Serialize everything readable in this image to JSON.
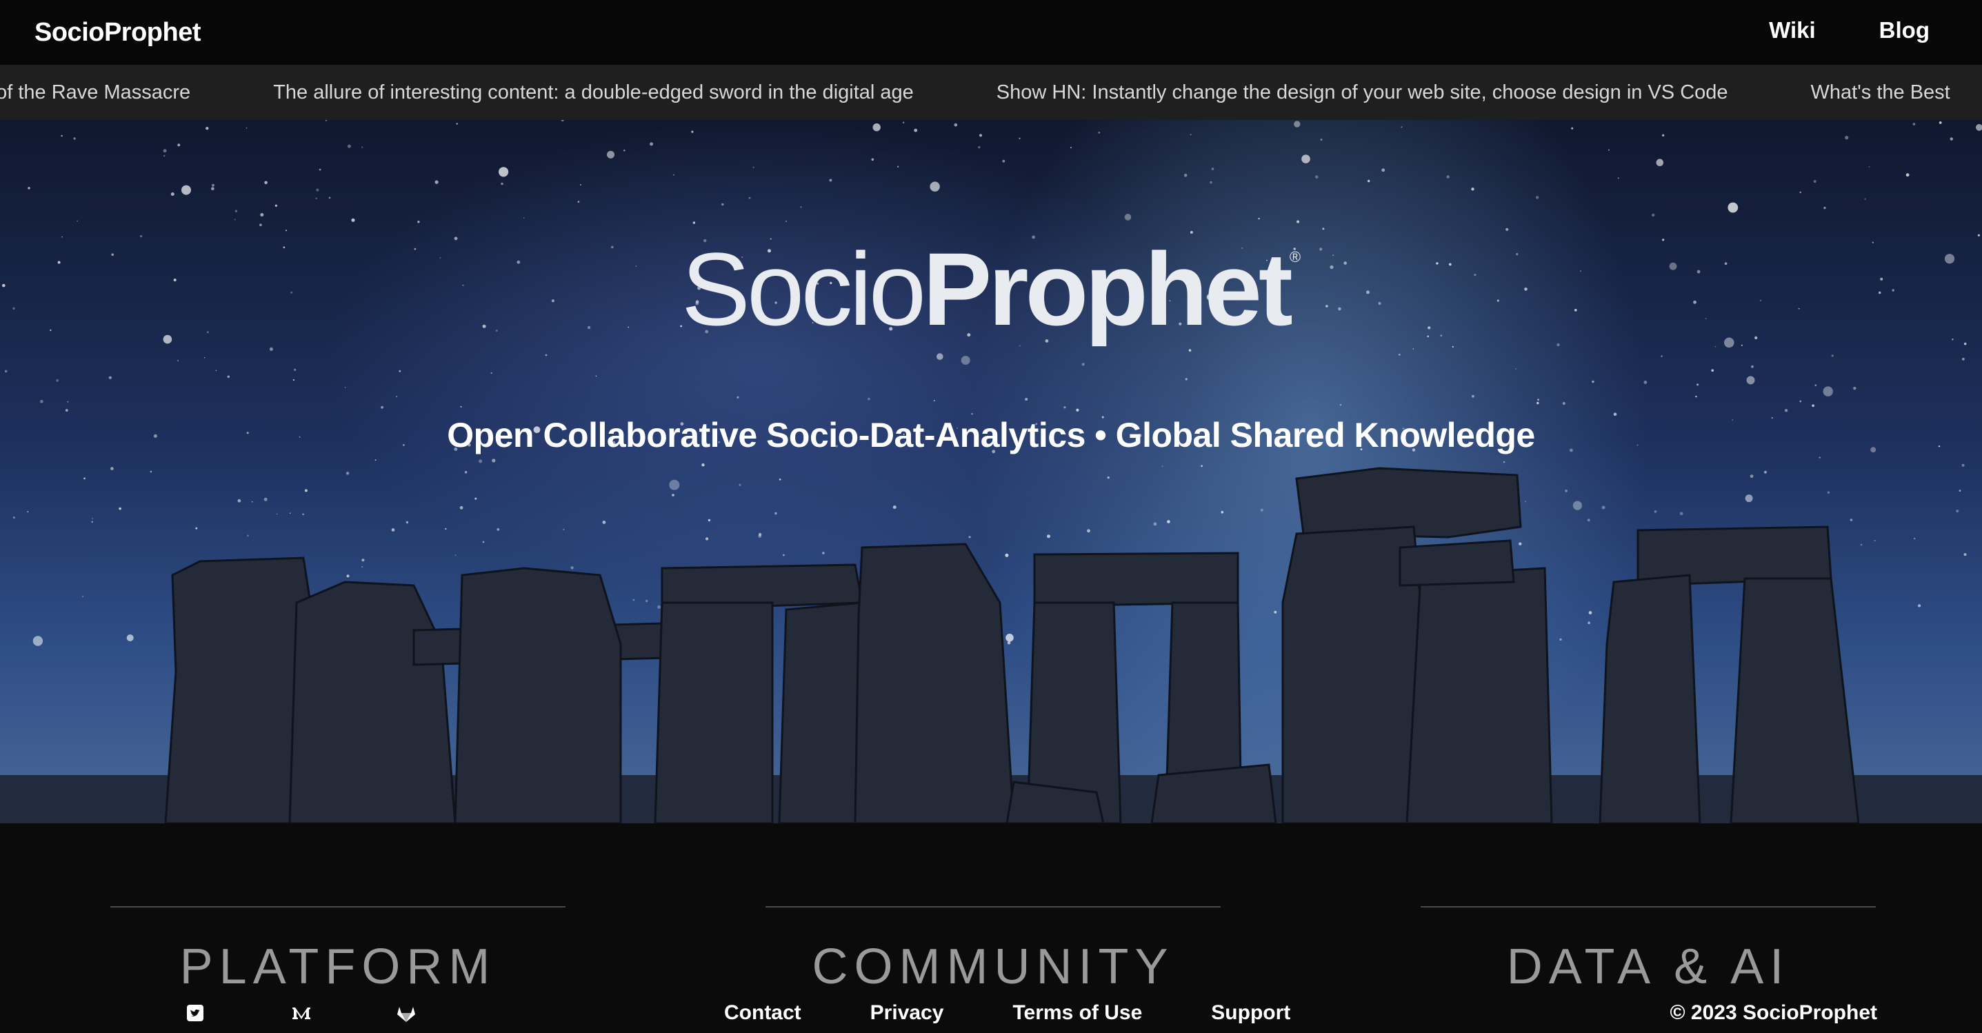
{
  "nav": {
    "brand": "SocioProphet",
    "links": [
      "Wiki",
      "Blog"
    ]
  },
  "ticker": {
    "items": [
      "t of the Rave Massacre",
      "The allure of interesting content: a double-edged sword in the digital age",
      "Show HN: Instantly change the design of your web site, choose design in VS Code",
      "What's the Best"
    ]
  },
  "hero": {
    "logo_light": "Socio",
    "logo_bold": "Prophet",
    "logo_mark": "®",
    "tagline": "Open Collaborative Socio-Dat-Analytics • Global Shared Knowledge"
  },
  "footer": {
    "sections": [
      "PLATFORM",
      "COMMUNITY",
      "DATA & AI"
    ],
    "social_icons": [
      "twitter-icon",
      "medium-icon",
      "gitlab-icon"
    ],
    "links": [
      "Contact",
      "Privacy",
      "Terms of Use",
      "Support"
    ],
    "copyright": "© 2023 SocioProphet"
  },
  "colors": {
    "nav_bg": "#070707",
    "ticker_bg": "#1f1f20",
    "footer_bg": "#0b0b0c",
    "section_heading": "#9a9a9a"
  }
}
